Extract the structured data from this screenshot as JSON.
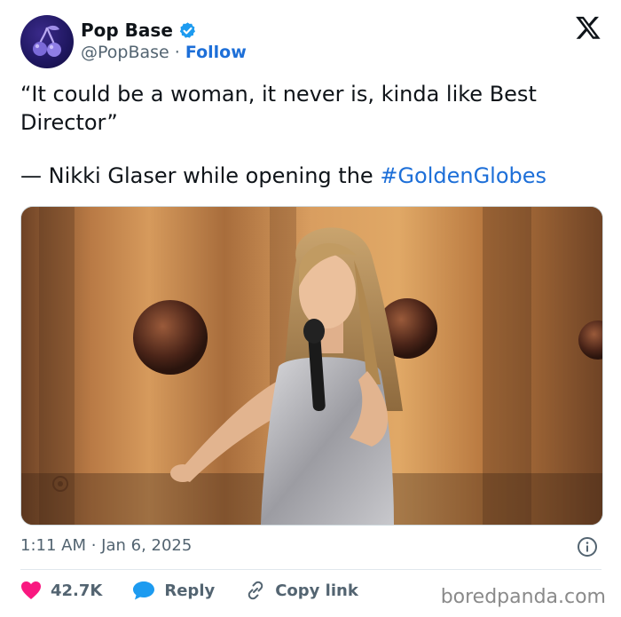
{
  "author": {
    "display_name": "Pop Base",
    "handle": "@PopBase",
    "separator": "·",
    "follow_label": "Follow",
    "verified": true,
    "avatar_icon": "cherry-logo-icon"
  },
  "platform_icon": "x-logo-icon",
  "tweet": {
    "quote_line": "“It could be a woman, it never is, kinda like Best Director”",
    "attribution_prefix": "— Nikki Glaser while opening the ",
    "hashtag": "#GoldenGlobes"
  },
  "media": {
    "type": "photo",
    "description_icon": "photo-media"
  },
  "meta": {
    "timestamp": "1:11 AM · Jan 6, 2025"
  },
  "actions": {
    "like_count": "42.7K",
    "reply_label": "Reply",
    "copy_link_label": "Copy link"
  },
  "watermark": "boredpanda.com",
  "colors": {
    "link_blue": "#1d6fd8",
    "like_red": "#f91880",
    "reply_blue": "#1d9bf0",
    "secondary_text": "#536471"
  }
}
